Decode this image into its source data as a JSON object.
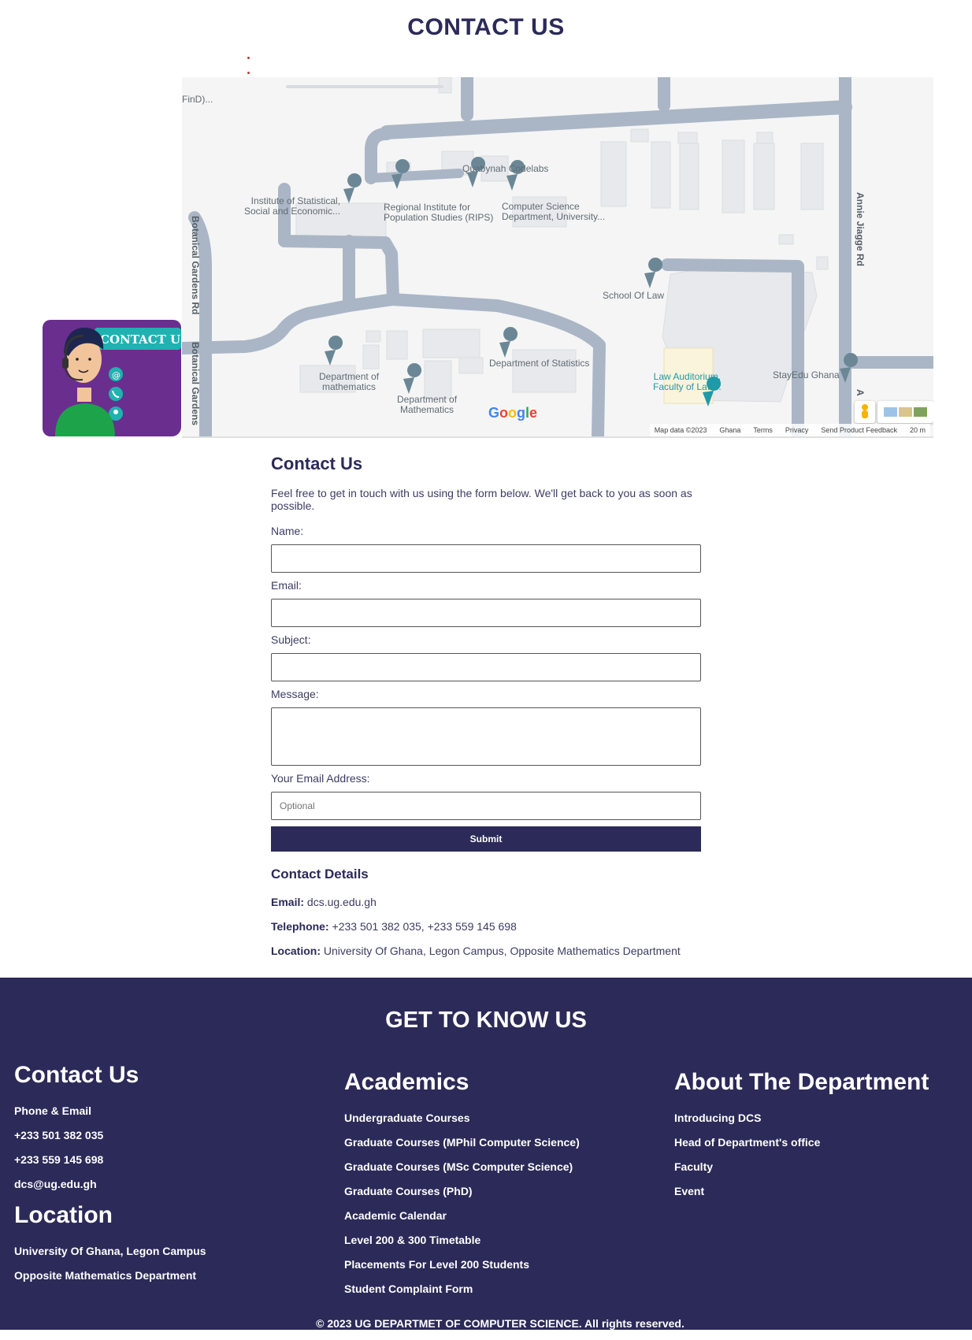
{
  "page": {
    "title": "CONTACT US"
  },
  "illustration": {
    "badge_text": "CONTACT US"
  },
  "map": {
    "places": [
      {
        "name": "Quabynah Codelabs"
      },
      {
        "name": "Institute of Statistical,\nSocial and Economic..."
      },
      {
        "name": "Regional Institute for\nPopulation Studies (RIPS)"
      },
      {
        "name": "Computer Science\nDepartment, University..."
      },
      {
        "name": "School Of Law"
      },
      {
        "name": "Department of\nmathematics"
      },
      {
        "name": "Department of\nMathematics"
      },
      {
        "name": "Department of Statistics"
      },
      {
        "name": "Law Auditorium,\nFaculty of Law..."
      },
      {
        "name": "StayEdu Ghana"
      },
      {
        "name": "FinD)..."
      }
    ],
    "roads": [
      "Botanical Gardens Rd",
      "Botanical Gardens",
      "Annie Jiagge Rd",
      "A"
    ],
    "logo": "Google",
    "footer": [
      "Map data ©2023",
      "Ghana",
      "Terms",
      "Privacy",
      "Send Product Feedback",
      "20 m"
    ]
  },
  "form": {
    "heading": "Contact Us",
    "intro": "Feel free to get in touch with us using the form below. We'll get back to you as soon as possible.",
    "name_label": "Name:",
    "email_label": "Email:",
    "subject_label": "Subject:",
    "message_label": "Message:",
    "your_email_label": "Your Email Address:",
    "your_email_placeholder": "Optional",
    "submit_label": "Submit"
  },
  "contact_details": {
    "heading": "Contact Details",
    "email_label": "Email:",
    "email_value": "dcs.ug.edu.gh",
    "telephone_label": "Telephone:",
    "telephone_value": "+233 501 382 035, +233 559 145 698",
    "location_label": "Location:",
    "location_value": "University Of Ghana, Legon Campus, Opposite Mathematics Department"
  },
  "footer": {
    "title": "GET TO KNOW US",
    "contact": {
      "heading": "Contact Us",
      "items": [
        "Phone & Email",
        "+233 501 382 035",
        "+233 559 145 698",
        "dcs@ug.edu.gh"
      ]
    },
    "location": {
      "heading": "Location",
      "items": [
        "University Of Ghana, Legon Campus",
        "Opposite Mathematics Department"
      ]
    },
    "academics": {
      "heading": "Academics",
      "items": [
        "Undergraduate Courses",
        "Graduate Courses (MPhil Computer Science)",
        "Graduate Courses (MSc Computer Science)",
        "Graduate Courses (PhD)",
        "Academic Calendar",
        "Level 200 & 300 Timetable",
        "Placements For Level 200 Students",
        "Student Complaint Form"
      ]
    },
    "about": {
      "heading": "About The Department",
      "items": [
        "Introducing DCS",
        "Head of Department's office",
        "Faculty",
        "Event"
      ]
    },
    "copyright": "© 2023 UG DEPARTMET OF COMPUTER SCIENCE. All rights reserved."
  },
  "colors": {
    "brand_navy": "#2b2a58",
    "map_road": "#aab6c6",
    "map_pin": "#6b8796",
    "map_pin_teal": "#1e9aa8"
  }
}
